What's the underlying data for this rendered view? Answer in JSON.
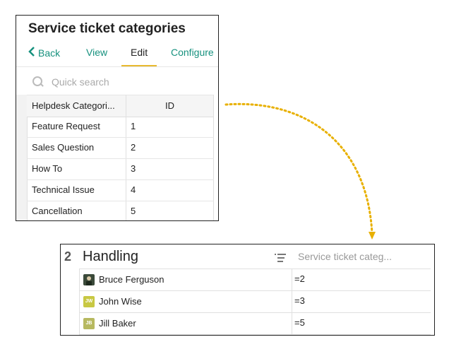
{
  "top_panel": {
    "title": "Service ticket categories",
    "tabs": [
      {
        "label": "Back",
        "active": false
      },
      {
        "label": "View",
        "active": false
      },
      {
        "label": "Edit",
        "active": true
      },
      {
        "label": "Configure",
        "active": false
      }
    ],
    "search": {
      "placeholder": "Quick search"
    },
    "table": {
      "columns": [
        "Helpdesk Categori...",
        "ID"
      ],
      "rows": [
        {
          "name": "Feature Request",
          "id": "1"
        },
        {
          "name": "Sales Question",
          "id": "2"
        },
        {
          "name": "How To",
          "id": "3"
        },
        {
          "name": "Technical Issue",
          "id": "4"
        },
        {
          "name": "Cancellation",
          "id": "5"
        }
      ]
    }
  },
  "bottom_panel": {
    "section_number": "2",
    "section_title": "Handling",
    "column_header": "Service ticket categ...",
    "rows": [
      {
        "name": "Bruce Ferguson",
        "initials": "",
        "avatar_color": "#3b4a3a",
        "value": "=2"
      },
      {
        "name": "John Wise",
        "initials": "JW",
        "avatar_color": "#c8c843",
        "value": "=3"
      },
      {
        "name": "Jill Baker",
        "initials": "JB",
        "avatar_color": "#b7b960",
        "value": "=5"
      }
    ]
  },
  "colors": {
    "accent_teal": "#16917e",
    "active_tab_underline": "#e8b92e",
    "arrow": "#e8b000"
  }
}
